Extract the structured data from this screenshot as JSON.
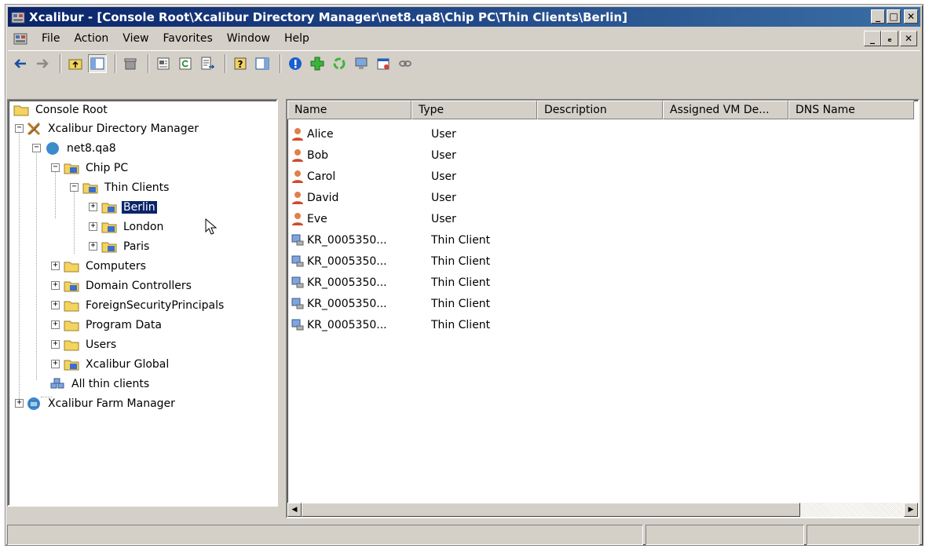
{
  "window": {
    "title": "Xcalibur - [Console Root\\Xcalibur Directory Manager\\net8.qa8\\Chip PC\\Thin Clients\\Berlin]",
    "buttons": {
      "minimize": "_",
      "maximize": "□",
      "close": "✕"
    }
  },
  "menubar": {
    "items": [
      {
        "label": "File"
      },
      {
        "label": "Action"
      },
      {
        "label": "View"
      },
      {
        "label": "Favorites"
      },
      {
        "label": "Window"
      },
      {
        "label": "Help"
      }
    ],
    "mdi_buttons": {
      "minimize": "_",
      "restore": "ₑ",
      "close": "✕"
    }
  },
  "toolbar": {
    "icons": [
      "back-icon",
      "forward-icon",
      "up-one-level-icon",
      "show-hide-tree-icon",
      "delete-icon",
      "properties-icon",
      "refresh-icon",
      "export-list-icon",
      "help-icon",
      "show-hide-action-pane-icon",
      "info-icon",
      "add-icon",
      "recycle-icon",
      "computer-icon",
      "calendar-icon",
      "link-icon"
    ]
  },
  "tree": {
    "items": [
      {
        "label": "Console Root",
        "icon": "folder-icon"
      },
      {
        "label": "Xcalibur Directory Manager",
        "icon": "directory-manager-icon"
      },
      {
        "label": "net8.qa8",
        "icon": "globe-icon"
      },
      {
        "label": "Chip PC",
        "icon": "ou-folder-icon"
      },
      {
        "label": "Thin Clients",
        "icon": "ou-folder-icon"
      },
      {
        "label": "Berlin",
        "icon": "ou-folder-icon",
        "selected": true
      },
      {
        "label": "London",
        "icon": "ou-folder-icon"
      },
      {
        "label": "Paris",
        "icon": "ou-folder-icon"
      },
      {
        "label": "Computers",
        "icon": "folder-icon"
      },
      {
        "label": "Domain Controllers",
        "icon": "ou-folder-icon"
      },
      {
        "label": "ForeignSecurityPrincipals",
        "icon": "folder-icon"
      },
      {
        "label": "Program Data",
        "icon": "folder-icon"
      },
      {
        "label": "Users",
        "icon": "folder-icon"
      },
      {
        "label": "Xcalibur Global",
        "icon": "ou-folder-icon"
      },
      {
        "label": "All thin clients",
        "icon": "thin-clients-group-icon"
      },
      {
        "label": "Xcalibur Farm Manager",
        "icon": "farm-manager-icon"
      }
    ]
  },
  "list": {
    "columns": [
      "Name",
      "Type",
      "Description",
      "Assigned VM De...",
      "DNS Name"
    ],
    "rows": [
      {
        "name": "Alice",
        "type": "User",
        "icon": "user-icon"
      },
      {
        "name": "Bob",
        "type": "User",
        "icon": "user-icon"
      },
      {
        "name": "Carol",
        "type": "User",
        "icon": "user-icon"
      },
      {
        "name": "David",
        "type": "User",
        "icon": "user-icon"
      },
      {
        "name": "Eve",
        "type": "User",
        "icon": "user-icon"
      },
      {
        "name": "KR_0005350...",
        "type": "Thin Client",
        "icon": "thin-client-icon"
      },
      {
        "name": "KR_0005350...",
        "type": "Thin Client",
        "icon": "thin-client-icon"
      },
      {
        "name": "KR_0005350...",
        "type": "Thin Client",
        "icon": "thin-client-icon"
      },
      {
        "name": "KR_0005350...",
        "type": "Thin Client",
        "icon": "thin-client-icon"
      },
      {
        "name": "KR_0005350...",
        "type": "Thin Client",
        "icon": "thin-client-icon"
      }
    ]
  },
  "colors": {
    "title_bar": "#0a246a",
    "selection": "#0a246a",
    "face": "#d4d0c8"
  }
}
